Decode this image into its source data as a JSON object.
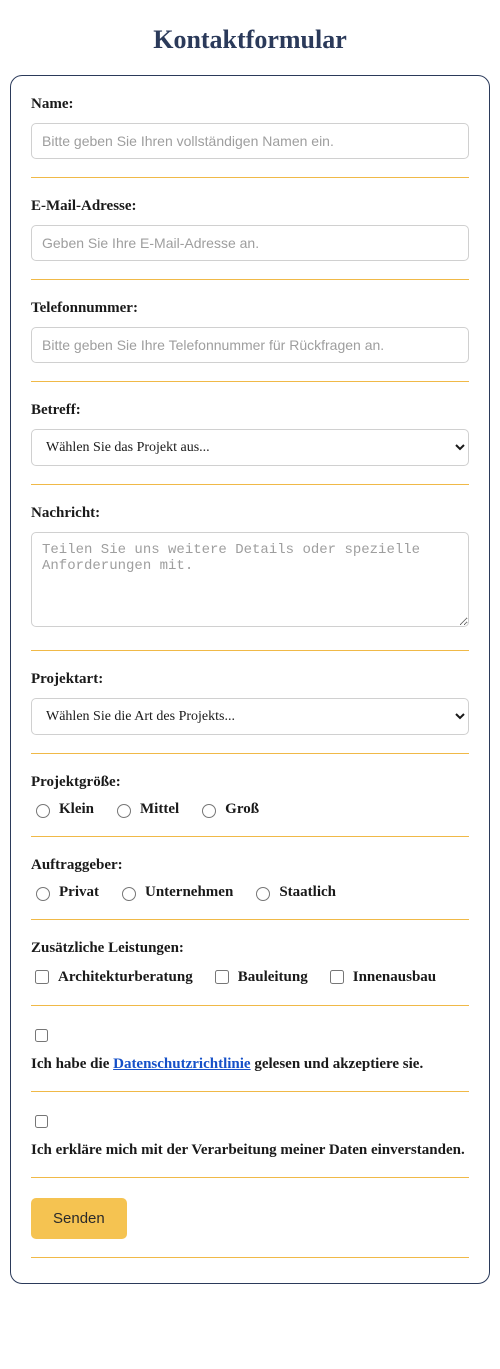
{
  "title": "Kontaktformular",
  "fields": {
    "name": {
      "label": "Name:",
      "placeholder": "Bitte geben Sie Ihren vollständigen Namen ein."
    },
    "email": {
      "label": "E-Mail-Adresse:",
      "placeholder": "Geben Sie Ihre E-Mail-Adresse an."
    },
    "phone": {
      "label": "Telefonnummer:",
      "placeholder": "Bitte geben Sie Ihre Telefonnummer für Rückfragen an."
    },
    "subject": {
      "label": "Betreff:",
      "placeholder": "Wählen Sie das Projekt aus..."
    },
    "message": {
      "label": "Nachricht:",
      "placeholder": "Teilen Sie uns weitere Details oder spezielle Anforderungen mit."
    },
    "project_type": {
      "label": "Projektart:",
      "placeholder": "Wählen Sie die Art des Projekts..."
    },
    "project_size": {
      "label": "Projektgröße:",
      "options": [
        "Klein",
        "Mittel",
        "Groß"
      ]
    },
    "client": {
      "label": "Auftraggeber:",
      "options": [
        "Privat",
        "Unternehmen",
        "Staatlich"
      ]
    },
    "services": {
      "label": "Zusätzliche Leistungen:",
      "options": [
        "Architekturberatung",
        "Bauleitung",
        "Innenausbau"
      ]
    },
    "privacy": {
      "pre": "Ich habe die ",
      "link": "Datenschutzrichtlinie",
      "post": " gelesen und akzeptiere sie."
    },
    "consent": {
      "text": "Ich erkläre mich mit der Verarbeitung meiner Daten einverstanden."
    }
  },
  "submit": "Senden"
}
